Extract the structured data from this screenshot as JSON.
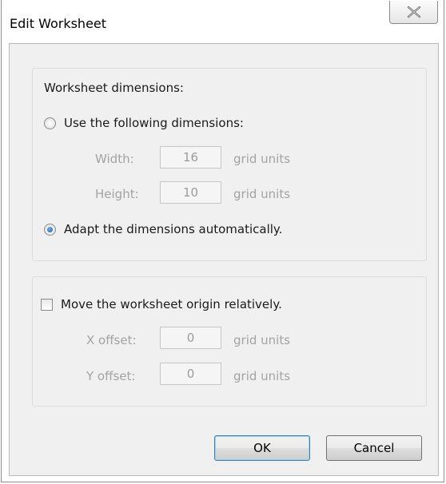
{
  "window": {
    "title": "Edit Worksheet",
    "close_icon": "close-x-icon"
  },
  "dimensions_group": {
    "heading": "Worksheet dimensions:",
    "use_following_label": "Use the following dimensions:",
    "use_following_checked": false,
    "width_label": "Width:",
    "width_value": "16",
    "width_unit": "grid units",
    "height_label": "Height:",
    "height_value": "10",
    "height_unit": "grid units",
    "adapt_label": "Adapt the dimensions automatically.",
    "adapt_checked": true
  },
  "origin_group": {
    "move_label": "Move the worksheet origin relatively.",
    "move_checked": false,
    "x_label": "X offset:",
    "x_value": "0",
    "x_unit": "grid units",
    "y_label": "Y offset:",
    "y_value": "0",
    "y_unit": "grid units"
  },
  "buttons": {
    "ok": "OK",
    "cancel": "Cancel"
  }
}
